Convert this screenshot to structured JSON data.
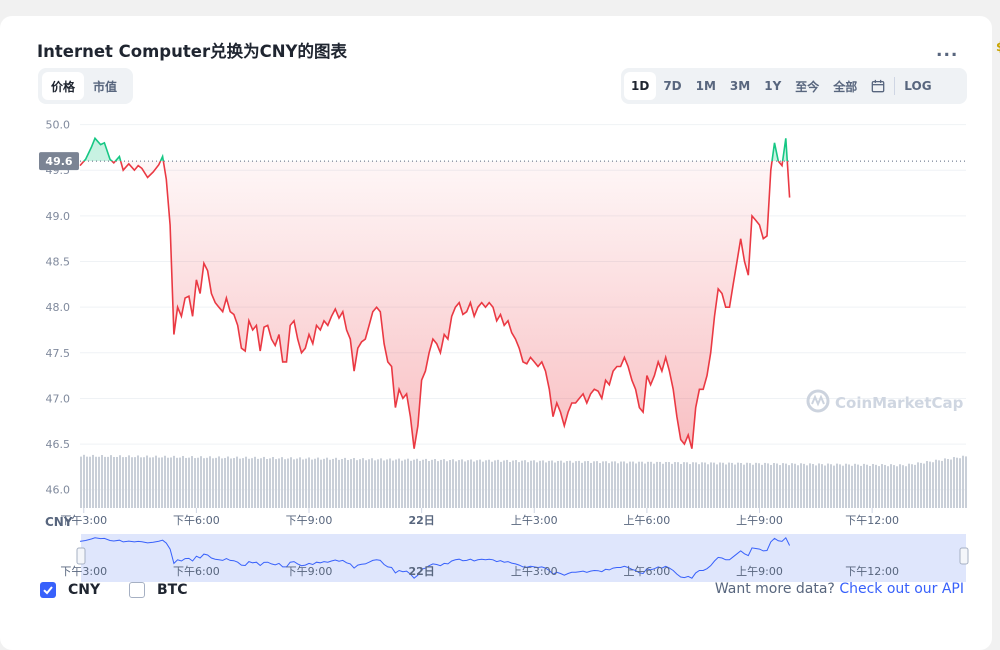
{
  "title": "Internet Computer兑换为CNY的图表",
  "more_label": "...",
  "edge_mark": "$",
  "chart_types": [
    {
      "label": "价格",
      "active": true
    },
    {
      "label": "市值",
      "active": false
    }
  ],
  "ranges": [
    {
      "label": "1D",
      "active": true
    },
    {
      "label": "7D",
      "active": false
    },
    {
      "label": "1M",
      "active": false
    },
    {
      "label": "3M",
      "active": false
    },
    {
      "label": "1Y",
      "active": false
    },
    {
      "label": "至今",
      "active": false
    },
    {
      "label": "全部",
      "active": false
    }
  ],
  "log_label": "LOG",
  "currency_checks": [
    {
      "label": "CNY",
      "checked": true
    },
    {
      "label": "BTC",
      "checked": false
    }
  ],
  "more_data_text": "Want more data?",
  "more_data_link": "Check out our API",
  "colors": {
    "up": "#16c784",
    "down": "#ea3943",
    "accent": "#3861fb",
    "volume": "#c9cfd8",
    "navigator_line": "#3861fb",
    "navigator_fill": "#dfe6fc"
  },
  "chart_data": {
    "type": "line",
    "currency_axis_label": "CNY",
    "reference_value": 49.6,
    "reference_label": "49.6",
    "y_ticks": [
      46.0,
      46.5,
      47.0,
      47.5,
      48.0,
      48.5,
      49.0,
      49.5,
      50.0
    ],
    "y_tick_labels": [
      "46.0",
      "46.5",
      "47.0",
      "47.5",
      "48.0",
      "48.5",
      "49.0",
      "49.5",
      "50.0"
    ],
    "ylim": [
      45.8,
      50.05
    ],
    "x_range": [
      14.9,
      38.5
    ],
    "x_ticks": [
      15,
      18,
      21,
      24,
      27,
      30,
      33,
      36
    ],
    "x_tick_labels": [
      "下午3:00",
      "下午6:00",
      "下午9:00",
      "22日",
      "上午3:00",
      "上午6:00",
      "上午9:00",
      "下午12:00"
    ],
    "watermark": "CoinMarketCap",
    "series": [
      {
        "values": [
          [
            14.9,
            49.55
          ],
          [
            15.05,
            49.62
          ],
          [
            15.2,
            49.75
          ],
          [
            15.3,
            49.85
          ],
          [
            15.45,
            49.78
          ],
          [
            15.55,
            49.8
          ],
          [
            15.7,
            49.62
          ],
          [
            15.8,
            49.58
          ],
          [
            15.95,
            49.65
          ],
          [
            16.05,
            49.5
          ],
          [
            16.2,
            49.57
          ],
          [
            16.35,
            49.5
          ],
          [
            16.45,
            49.55
          ],
          [
            16.55,
            49.52
          ],
          [
            16.7,
            49.42
          ],
          [
            16.85,
            49.48
          ],
          [
            17.0,
            49.56
          ],
          [
            17.1,
            49.65
          ],
          [
            17.2,
            49.4
          ],
          [
            17.3,
            48.9
          ],
          [
            17.4,
            47.7
          ],
          [
            17.5,
            48.0
          ],
          [
            17.6,
            47.9
          ],
          [
            17.7,
            48.1
          ],
          [
            17.8,
            48.12
          ],
          [
            17.9,
            47.9
          ],
          [
            18.0,
            48.3
          ],
          [
            18.1,
            48.15
          ],
          [
            18.2,
            48.48
          ],
          [
            18.3,
            48.4
          ],
          [
            18.4,
            48.15
          ],
          [
            18.5,
            48.05
          ],
          [
            18.6,
            48.0
          ],
          [
            18.7,
            47.95
          ],
          [
            18.8,
            48.1
          ],
          [
            18.9,
            47.95
          ],
          [
            19.0,
            47.92
          ],
          [
            19.1,
            47.8
          ],
          [
            19.2,
            47.55
          ],
          [
            19.3,
            47.52
          ],
          [
            19.4,
            47.85
          ],
          [
            19.5,
            47.75
          ],
          [
            19.6,
            47.8
          ],
          [
            19.7,
            47.52
          ],
          [
            19.8,
            47.78
          ],
          [
            19.9,
            47.8
          ],
          [
            20.0,
            47.65
          ],
          [
            20.1,
            47.58
          ],
          [
            20.2,
            47.7
          ],
          [
            20.3,
            47.4
          ],
          [
            20.4,
            47.4
          ],
          [
            20.5,
            47.8
          ],
          [
            20.6,
            47.85
          ],
          [
            20.7,
            47.65
          ],
          [
            20.8,
            47.5
          ],
          [
            20.9,
            47.55
          ],
          [
            21.0,
            47.7
          ],
          [
            21.1,
            47.6
          ],
          [
            21.2,
            47.8
          ],
          [
            21.3,
            47.75
          ],
          [
            21.4,
            47.85
          ],
          [
            21.5,
            47.8
          ],
          [
            21.6,
            47.9
          ],
          [
            21.7,
            47.98
          ],
          [
            21.8,
            47.88
          ],
          [
            21.9,
            47.95
          ],
          [
            22.0,
            47.75
          ],
          [
            22.1,
            47.65
          ],
          [
            22.2,
            47.3
          ],
          [
            22.3,
            47.55
          ],
          [
            22.4,
            47.62
          ],
          [
            22.5,
            47.65
          ],
          [
            22.6,
            47.8
          ],
          [
            22.7,
            47.95
          ],
          [
            22.8,
            48.0
          ],
          [
            22.9,
            47.95
          ],
          [
            23.0,
            47.6
          ],
          [
            23.1,
            47.4
          ],
          [
            23.2,
            47.35
          ],
          [
            23.3,
            46.9
          ],
          [
            23.4,
            47.1
          ],
          [
            23.5,
            47.0
          ],
          [
            23.6,
            47.05
          ],
          [
            23.7,
            46.8
          ],
          [
            23.8,
            46.45
          ],
          [
            23.9,
            46.7
          ],
          [
            24.0,
            47.2
          ],
          [
            24.1,
            47.3
          ],
          [
            24.2,
            47.5
          ],
          [
            24.3,
            47.65
          ],
          [
            24.4,
            47.6
          ],
          [
            24.5,
            47.5
          ],
          [
            24.6,
            47.7
          ],
          [
            24.7,
            47.65
          ],
          [
            24.8,
            47.9
          ],
          [
            24.9,
            48.0
          ],
          [
            25.0,
            48.05
          ],
          [
            25.1,
            47.92
          ],
          [
            25.2,
            47.95
          ],
          [
            25.3,
            48.05
          ],
          [
            25.4,
            47.9
          ],
          [
            25.5,
            48.0
          ],
          [
            25.6,
            48.05
          ],
          [
            25.7,
            48.0
          ],
          [
            25.8,
            48.05
          ],
          [
            25.9,
            48.0
          ],
          [
            26.0,
            47.85
          ],
          [
            26.1,
            47.92
          ],
          [
            26.2,
            47.8
          ],
          [
            26.3,
            47.85
          ],
          [
            26.4,
            47.72
          ],
          [
            26.5,
            47.65
          ],
          [
            26.6,
            47.55
          ],
          [
            26.7,
            47.4
          ],
          [
            26.8,
            47.38
          ],
          [
            26.9,
            47.45
          ],
          [
            27.0,
            47.4
          ],
          [
            27.1,
            47.35
          ],
          [
            27.2,
            47.4
          ],
          [
            27.3,
            47.3
          ],
          [
            27.4,
            47.1
          ],
          [
            27.5,
            46.8
          ],
          [
            27.6,
            46.95
          ],
          [
            27.7,
            46.85
          ],
          [
            27.8,
            46.7
          ],
          [
            27.9,
            46.85
          ],
          [
            28.0,
            46.95
          ],
          [
            28.1,
            46.95
          ],
          [
            28.2,
            47.0
          ],
          [
            28.3,
            47.05
          ],
          [
            28.4,
            46.95
          ],
          [
            28.5,
            47.05
          ],
          [
            28.6,
            47.1
          ],
          [
            28.7,
            47.08
          ],
          [
            28.8,
            47.0
          ],
          [
            28.9,
            47.2
          ],
          [
            29.0,
            47.15
          ],
          [
            29.1,
            47.3
          ],
          [
            29.2,
            47.35
          ],
          [
            29.3,
            47.35
          ],
          [
            29.4,
            47.45
          ],
          [
            29.5,
            47.35
          ],
          [
            29.6,
            47.2
          ],
          [
            29.7,
            47.1
          ],
          [
            29.8,
            46.9
          ],
          [
            29.9,
            46.85
          ],
          [
            30.0,
            47.25
          ],
          [
            30.1,
            47.15
          ],
          [
            30.2,
            47.25
          ],
          [
            30.3,
            47.4
          ],
          [
            30.4,
            47.3
          ],
          [
            30.5,
            47.45
          ],
          [
            30.6,
            47.3
          ],
          [
            30.7,
            47.1
          ],
          [
            30.8,
            46.8
          ],
          [
            30.9,
            46.55
          ],
          [
            31.0,
            46.5
          ],
          [
            31.1,
            46.6
          ],
          [
            31.2,
            46.45
          ],
          [
            31.3,
            46.9
          ],
          [
            31.4,
            47.1
          ],
          [
            31.5,
            47.1
          ],
          [
            31.6,
            47.25
          ],
          [
            31.7,
            47.5
          ],
          [
            31.8,
            47.9
          ],
          [
            31.9,
            48.2
          ],
          [
            32.0,
            48.15
          ],
          [
            32.1,
            48.0
          ],
          [
            32.2,
            48.0
          ],
          [
            32.3,
            48.25
          ],
          [
            32.4,
            48.5
          ],
          [
            32.5,
            48.75
          ],
          [
            32.6,
            48.5
          ],
          [
            32.7,
            48.35
          ],
          [
            32.8,
            49.0
          ],
          [
            32.9,
            48.95
          ],
          [
            33.0,
            48.9
          ],
          [
            33.1,
            48.75
          ],
          [
            33.2,
            48.78
          ],
          [
            33.3,
            49.5
          ],
          [
            33.4,
            49.8
          ],
          [
            33.5,
            49.6
          ],
          [
            33.6,
            49.55
          ],
          [
            33.7,
            49.85
          ],
          [
            33.8,
            49.2
          ]
        ]
      }
    ]
  }
}
